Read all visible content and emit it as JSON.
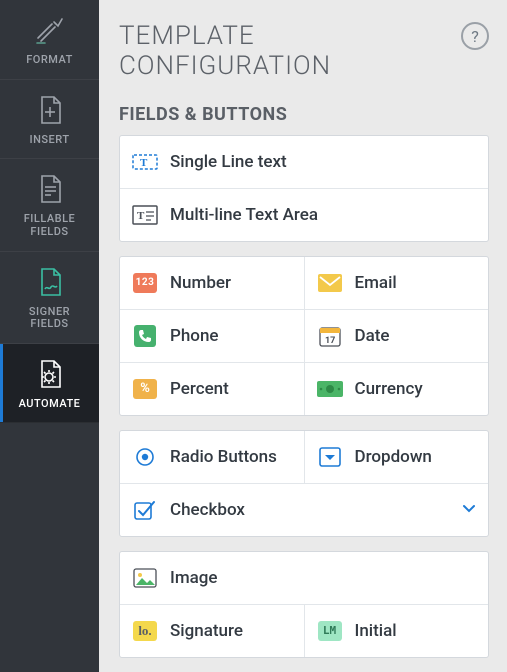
{
  "sidebar": {
    "items": [
      {
        "label": "FORMAT"
      },
      {
        "label": "INSERT"
      },
      {
        "label": "FILLABLE\nFIELDS"
      },
      {
        "label": "SIGNER\nFIELDS"
      },
      {
        "label": "AUTOMATE"
      }
    ]
  },
  "panel": {
    "title": "TEMPLATE\nCONFIGURATION",
    "help": "?",
    "section_title": "FIELDS & BUTTONS"
  },
  "fields": {
    "single_line": "Single Line text",
    "multi_line": "Multi-line Text Area",
    "number": "Number",
    "number_chip": "123",
    "email": "Email",
    "phone": "Phone",
    "date": "Date",
    "date_chip": "17",
    "percent": "Percent",
    "percent_chip": "%",
    "currency": "Currency",
    "radio": "Radio Buttons",
    "dropdown": "Dropdown",
    "checkbox": "Checkbox",
    "image": "Image",
    "signature": "Signature",
    "signature_chip": "lo.",
    "initial": "Initial",
    "initial_chip": "LM"
  }
}
